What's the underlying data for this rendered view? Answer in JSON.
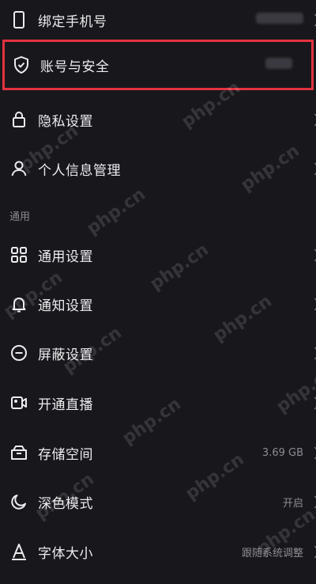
{
  "settings": {
    "items": [
      {
        "label": "绑定手机号",
        "icon": "phone-icon",
        "value": ""
      },
      {
        "label": "账号与安全",
        "icon": "shield-icon",
        "value": ""
      },
      {
        "label": "隐私设置",
        "icon": "lock-icon",
        "value": ""
      },
      {
        "label": "个人信息管理",
        "icon": "person-icon",
        "value": ""
      }
    ],
    "general_header": "通用",
    "general_items": [
      {
        "label": "通用设置",
        "icon": "grid-icon",
        "value": ""
      },
      {
        "label": "通知设置",
        "icon": "bell-icon",
        "value": ""
      },
      {
        "label": "屏蔽设置",
        "icon": "block-icon",
        "value": ""
      },
      {
        "label": "开通直播",
        "icon": "live-camera-icon",
        "value": ""
      },
      {
        "label": "存储空间",
        "icon": "storage-icon",
        "value": "3.69 GB"
      },
      {
        "label": "深色模式",
        "icon": "moon-icon",
        "value": "开启"
      },
      {
        "label": "字体大小",
        "icon": "font-size-icon",
        "value": "跟随系统调整"
      }
    ]
  },
  "watermark": "php.cn",
  "colors": {
    "background": "#18181c",
    "highlight": "#e2323f",
    "text": "#ececef",
    "secondary": "#8b8b93"
  }
}
